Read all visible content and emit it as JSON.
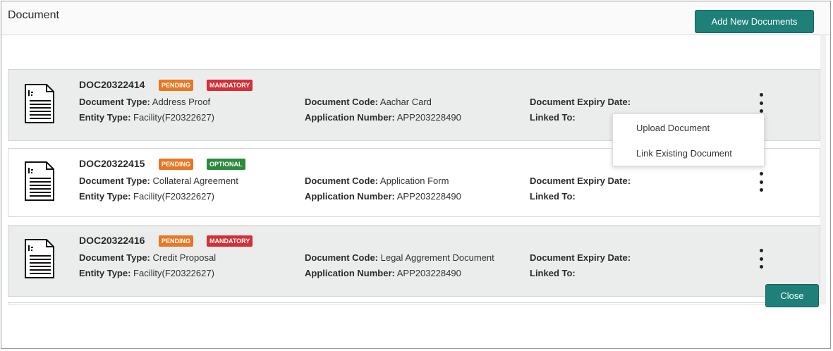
{
  "dialog": {
    "title": "Document"
  },
  "toolbar": {
    "add_label": "Add New Documents"
  },
  "footer": {
    "close_label": "Close"
  },
  "colors": {
    "accent": "#1f7f79",
    "pending": "#e87722",
    "mandatory": "#d62e36",
    "optional": "#2b8a3e"
  },
  "documents": [
    {
      "id": "DOC20322414",
      "status": "PENDING",
      "requirement": "MANDATORY",
      "type_label": "Document Type:",
      "type_value": " Address Proof",
      "entity_label": "Entity Type:",
      "entity_value": " Facility(F20322627)",
      "code_label": "Document Code:",
      "code_value": " Aachar Card",
      "app_label": "Application Number:",
      "app_value": " APP203228490",
      "expiry_label": "Document Expiry Date:",
      "linked_label": "Linked To:"
    },
    {
      "id": "DOC20322415",
      "status": "PENDING",
      "requirement": "OPTIONAL",
      "type_label": "Document Type:",
      "type_value": " Collateral Agreement",
      "entity_label": "Entity Type:",
      "entity_value": " Facility(F20322627)",
      "code_label": "Document Code:",
      "code_value": " Application Form",
      "app_label": "Application Number:",
      "app_value": " APP203228490",
      "expiry_label": "Document Expiry Date:",
      "linked_label": "Linked To:"
    },
    {
      "id": "DOC20322416",
      "status": "PENDING",
      "requirement": "MANDATORY",
      "type_label": "Document Type:",
      "type_value": " Credit Proposal",
      "entity_label": "Entity Type:",
      "entity_value": " Facility(F20322627)",
      "code_label": "Document Code:",
      "code_value": " Legal Aggrement Document",
      "app_label": "Application Number:",
      "app_value": " APP203228490",
      "expiry_label": "Document Expiry Date:",
      "linked_label": "Linked To:"
    }
  ],
  "menu": {
    "upload": "Upload Document",
    "link": "Link Existing Document"
  }
}
